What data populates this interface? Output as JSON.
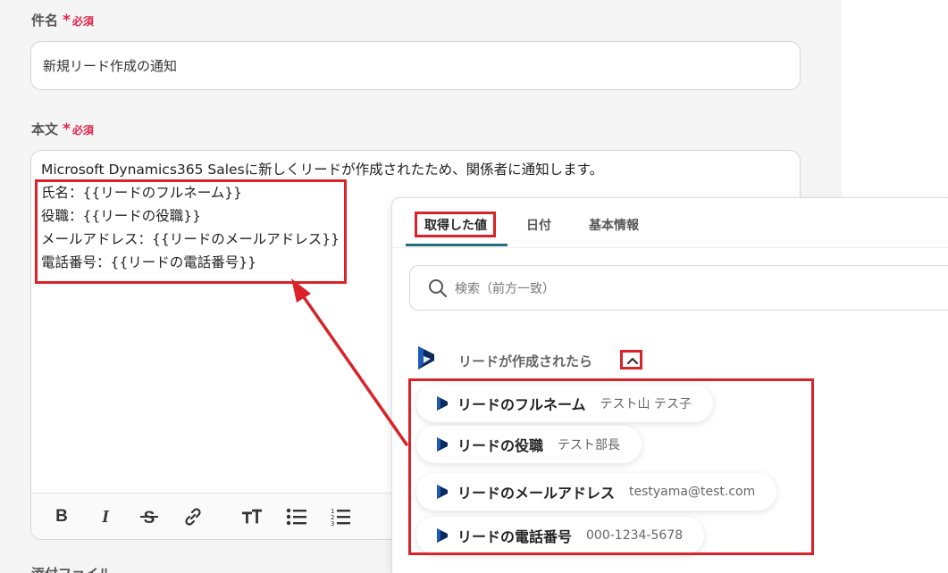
{
  "subject": {
    "label": "件名",
    "required": "必須",
    "value": "新規リード作成の通知"
  },
  "body": {
    "label": "本文",
    "required": "必須",
    "lines": [
      "Microsoft Dynamics365 Salesに新しくリードが作成されたため、関係者に通知します。",
      "氏名：{{リードのフルネーム}}",
      "役職：{{リードの役職}}",
      "メールアドレス：{{リードのメールアドレス}}",
      "電話番号：{{リードの電話番号}}"
    ]
  },
  "toolbar": {
    "icons": [
      "bold-icon",
      "italic-icon",
      "strikethrough-icon",
      "link-icon",
      "text-size-icon",
      "bullet-list-icon",
      "numbered-list-icon"
    ]
  },
  "next_field_label": "添付ファイル",
  "popup": {
    "tabs": [
      "取得した値",
      "日付",
      "基本情報"
    ],
    "search_placeholder": "検索（前方一致）",
    "group_title": "リードが作成されたら",
    "items": [
      {
        "name": "リードのフルネーム",
        "value": "テスト山 テス子"
      },
      {
        "name": "リードの役職",
        "value": "テスト部長"
      },
      {
        "name": "リードのメールアドレス",
        "value": "testyama@test.com"
      },
      {
        "name": "リードの電話番号",
        "value": "000-1234-5678"
      }
    ]
  },
  "colors": {
    "required": "#e0244b",
    "highlight": "#d8232a",
    "tab_underline": "#1f6f80",
    "dynamics_logo": "#0b2a5b"
  }
}
